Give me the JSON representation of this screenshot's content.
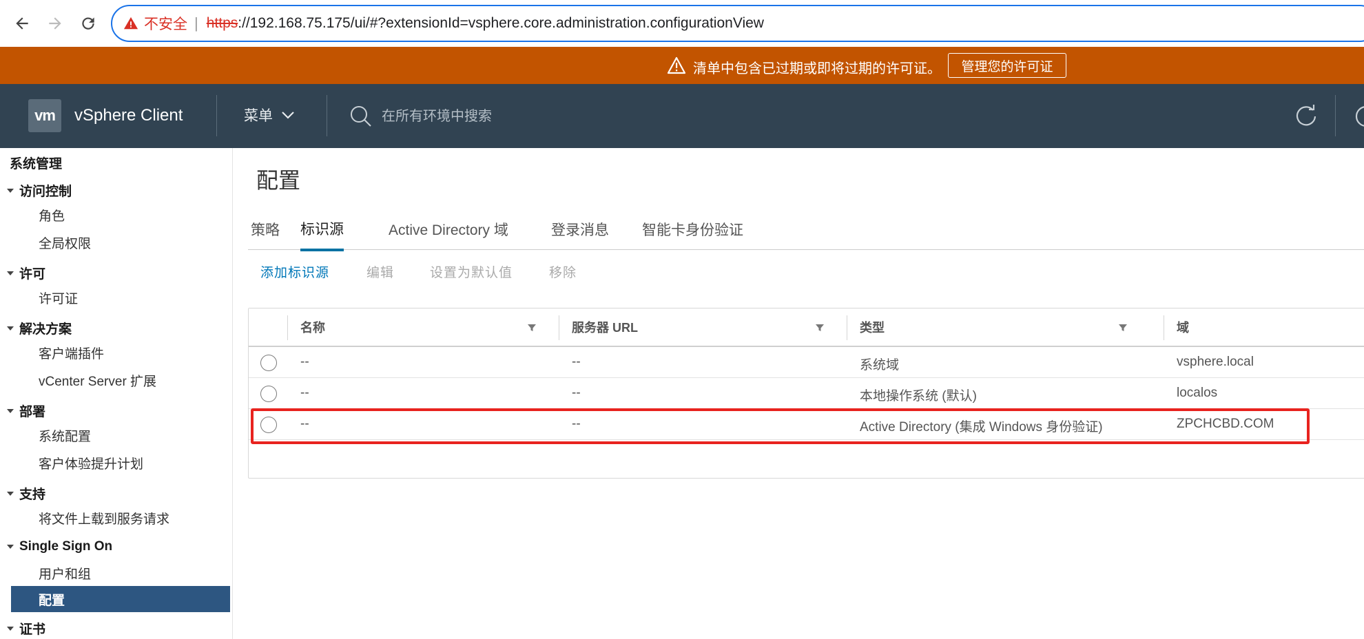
{
  "browser": {
    "insecure_label": "不安全",
    "url_scheme": "https",
    "url_rest": "://192.168.75.175/ui/#?extensionId=vsphere.core.administration.configurationView"
  },
  "banner": {
    "message": "清单中包含已过期或即将过期的许可证。",
    "button_label": "管理您的许可证",
    "color": "#c25400"
  },
  "header": {
    "logo_text": "vm",
    "app_title": "vSphere Client",
    "menu_label": "菜单",
    "search_placeholder": "在所有环境中搜索",
    "color": "#314352"
  },
  "sidebar": {
    "root": "系统管理",
    "groups": [
      {
        "label": "访问控制",
        "items": [
          "角色",
          "全局权限"
        ]
      },
      {
        "label": "许可",
        "items": [
          "许可证"
        ]
      },
      {
        "label": "解决方案",
        "items": [
          "客户端插件",
          "vCenter Server 扩展"
        ]
      },
      {
        "label": "部署",
        "items": [
          "系统配置",
          "客户体验提升计划"
        ]
      },
      {
        "label": "支持",
        "items": [
          "将文件上载到服务请求"
        ]
      },
      {
        "label": "Single Sign On",
        "items": [
          "用户和组",
          "配置"
        ]
      },
      {
        "label": "证书",
        "items": []
      }
    ],
    "active_item": "配置",
    "active_color": "#2d5681"
  },
  "main": {
    "title": "配置",
    "tabs": [
      "策略",
      "标识源",
      "Active Directory 域",
      "登录消息",
      "智能卡身份验证"
    ],
    "active_tab": "标识源",
    "toolbar": {
      "add": "添加标识源",
      "edit": "编辑",
      "set_default": "设置为默认值",
      "remove": "移除"
    },
    "table": {
      "columns": [
        "名称",
        "服务器 URL",
        "类型",
        "域"
      ],
      "rows": [
        {
          "name": "--",
          "url": "--",
          "type": "系统域",
          "domain": "vsphere.local"
        },
        {
          "name": "--",
          "url": "--",
          "type": "本地操作系统 (默认)",
          "domain": "localos"
        },
        {
          "name": "--",
          "url": "--",
          "type": "Active Directory (集成 Windows 身份验证)",
          "domain": "ZPCHCBD.COM"
        }
      ],
      "highlighted_row": 3,
      "highlight_color": "#e8231f"
    }
  }
}
